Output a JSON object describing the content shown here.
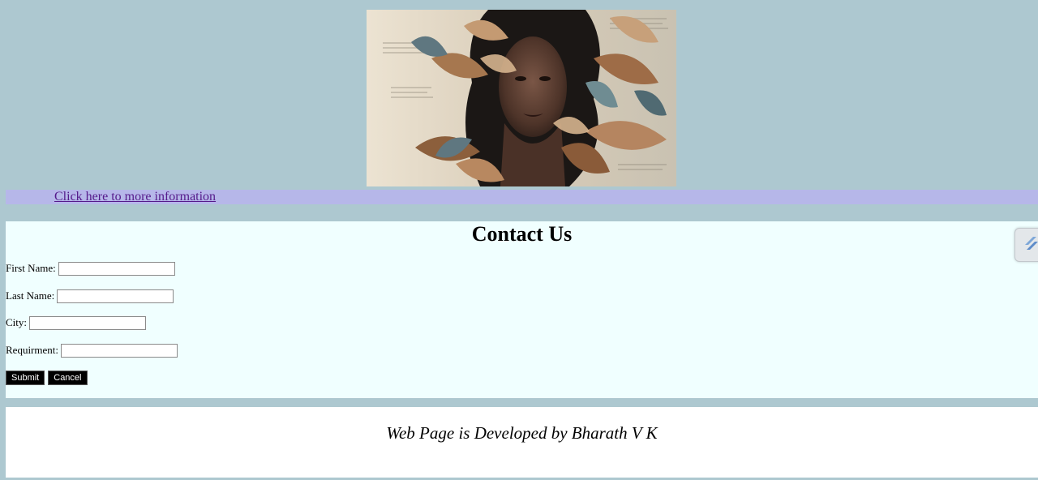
{
  "hero": {
    "image_name": "collage-portrait-woman-leaves"
  },
  "info_bar": {
    "link_text": "Click here to more information"
  },
  "contact": {
    "title": "Contact Us",
    "fields": [
      {
        "label": "First Name:",
        "value": ""
      },
      {
        "label": "Last Name:",
        "value": ""
      },
      {
        "label": "City:",
        "value": ""
      },
      {
        "label": "Requirment:",
        "value": ""
      }
    ],
    "submit_label": "Submit",
    "cancel_label": "Cancel"
  },
  "side_widget": {
    "icon": "extension-icon"
  },
  "footer": {
    "text": "Web Page is Developed by Bharath V K"
  },
  "colors": {
    "page_background": "#adc8d0",
    "info_bar_background": "#b6b7e9",
    "link": "#551a8b",
    "contact_background": "#f0ffff",
    "footer_background": "#ffffff",
    "button_background": "#000000"
  }
}
